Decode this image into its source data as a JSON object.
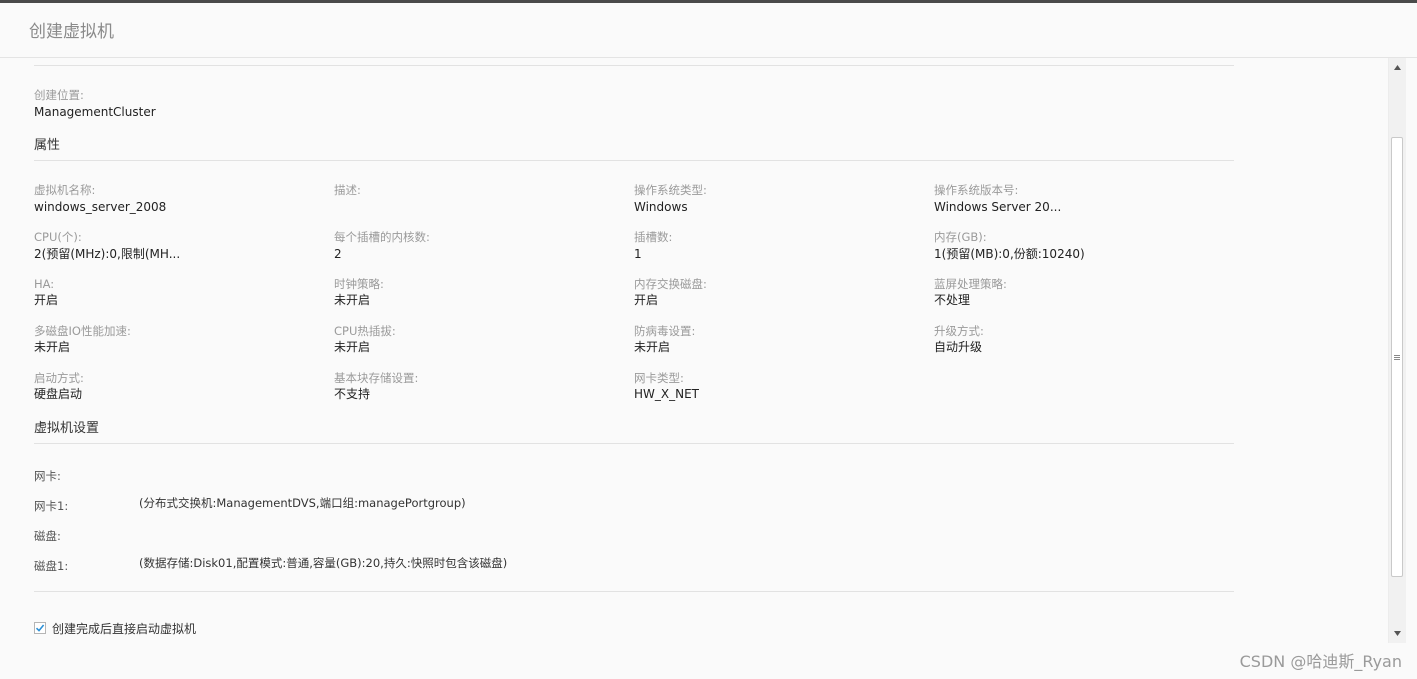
{
  "dialog": {
    "title": "创建虚拟机"
  },
  "location": {
    "label": "创建位置:",
    "value": "ManagementCluster"
  },
  "properties": {
    "title": "属性",
    "rows": [
      [
        {
          "label": "虚拟机名称:",
          "value": "windows_server_2008"
        },
        {
          "label": "描述:",
          "value": ""
        },
        {
          "label": "操作系统类型:",
          "value": "Windows"
        },
        {
          "label": "操作系统版本号:",
          "value": "Windows Server 20..."
        }
      ],
      [
        {
          "label": "CPU(个):",
          "value": "2(预留(MHz):0,限制(MH..."
        },
        {
          "label": "每个插槽的内核数:",
          "value": "2"
        },
        {
          "label": "插槽数:",
          "value": "1"
        },
        {
          "label": "内存(GB):",
          "value": "1(预留(MB):0,份额:10240)"
        }
      ],
      [
        {
          "label": "HA:",
          "value": "开启"
        },
        {
          "label": "时钟策略:",
          "value": "未开启"
        },
        {
          "label": "内存交换磁盘:",
          "value": "开启"
        },
        {
          "label": "蓝屏处理策略:",
          "value": "不处理"
        }
      ],
      [
        {
          "label": "多磁盘IO性能加速:",
          "value": "未开启"
        },
        {
          "label": "CPU热插拔:",
          "value": "未开启"
        },
        {
          "label": "防病毒设置:",
          "value": "未开启"
        },
        {
          "label": "升级方式:",
          "value": "自动升级"
        }
      ],
      [
        {
          "label": "启动方式:",
          "value": "硬盘启动"
        },
        {
          "label": "基本块存储设置:",
          "value": "不支持"
        },
        {
          "label": "网卡类型:",
          "value": "HW_X_NET"
        }
      ]
    ]
  },
  "vm_settings": {
    "title": "虚拟机设置",
    "nic_header": "网卡:",
    "nic1_label": "网卡1:",
    "nic1_value": "(分布式交换机:ManagementDVS,端口组:managePortgroup)",
    "disk_header": "磁盘:",
    "disk1_label": "磁盘1:",
    "disk1_value": "(数据存储:Disk01,配置模式:普通,容量(GB):20,持久:快照时包含该磁盘)"
  },
  "start_after_create": {
    "label": "创建完成后直接启动虚拟机",
    "checked": true
  },
  "watermark": "CSDN @哈迪斯_Ryan",
  "colors": {
    "checkmark": "#2b8fd6",
    "text": "#222222",
    "label": "#9a9a9a"
  }
}
